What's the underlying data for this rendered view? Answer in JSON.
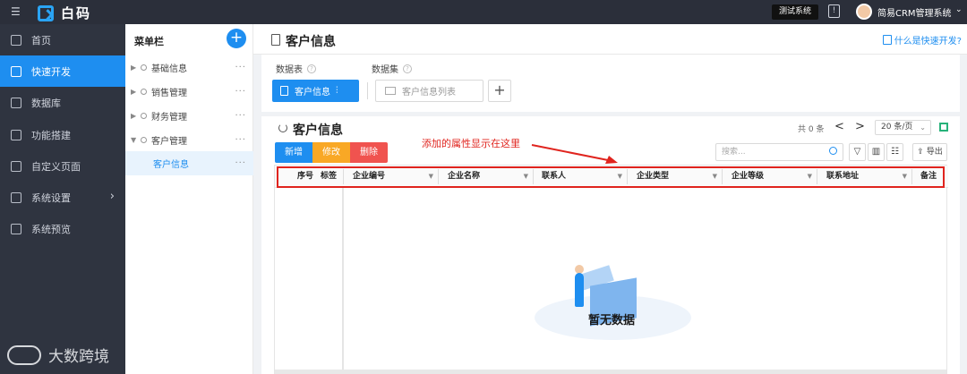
{
  "topbar": {
    "app_name": "白码",
    "env_tag": "测试系统",
    "system_name": "简易CRM管理系统"
  },
  "nav": {
    "items": [
      {
        "label": "首页",
        "icon": "home-icon",
        "active": false
      },
      {
        "label": "快速开发",
        "icon": "cube-icon",
        "active": true
      },
      {
        "label": "数据库",
        "icon": "database-icon",
        "active": false
      },
      {
        "label": "功能搭建",
        "icon": "build-icon",
        "active": false
      },
      {
        "label": "自定义页面",
        "icon": "page-icon",
        "active": false
      },
      {
        "label": "系统设置",
        "icon": "settings-icon",
        "active": false
      },
      {
        "label": "系统预览",
        "icon": "preview-icon",
        "active": false
      }
    ],
    "watermark": "大数跨境"
  },
  "menu": {
    "title": "菜单栏",
    "add": "+",
    "items": [
      {
        "label": "基础信息",
        "expanded": false
      },
      {
        "label": "销售管理",
        "expanded": false
      },
      {
        "label": "财务管理",
        "expanded": false
      },
      {
        "label": "客户管理",
        "expanded": true
      },
      {
        "label": "客户信息",
        "child": true,
        "selected": true
      }
    ]
  },
  "header": {
    "title": "客户信息",
    "help": "什么是快速开发?"
  },
  "tabs": {
    "datatable": "数据表",
    "dataset": "数据集",
    "table_button": "客户信息",
    "list_input": "客户信息列表",
    "plus": "+"
  },
  "grid": {
    "title": "客户信息",
    "total": "共 0 条",
    "page_size": "20 条/页",
    "prev": "<",
    "next": ">",
    "add": "新增",
    "edit": "修改",
    "delete": "删除",
    "annotation": "添加的属性显示在这里",
    "search_placeholder": "搜索...",
    "export": "导出",
    "columns": [
      "序号",
      "标签",
      "企业编号",
      "企业名称",
      "联系人",
      "企业类型",
      "企业等级",
      "联系地址",
      "备注"
    ],
    "empty": "暂无数据"
  },
  "colors": {
    "primary": "#1e8ef0",
    "warning": "#f9a825",
    "danger": "#f0534f",
    "annotation": "#e0241e",
    "nav_bg": "#2f3440"
  }
}
